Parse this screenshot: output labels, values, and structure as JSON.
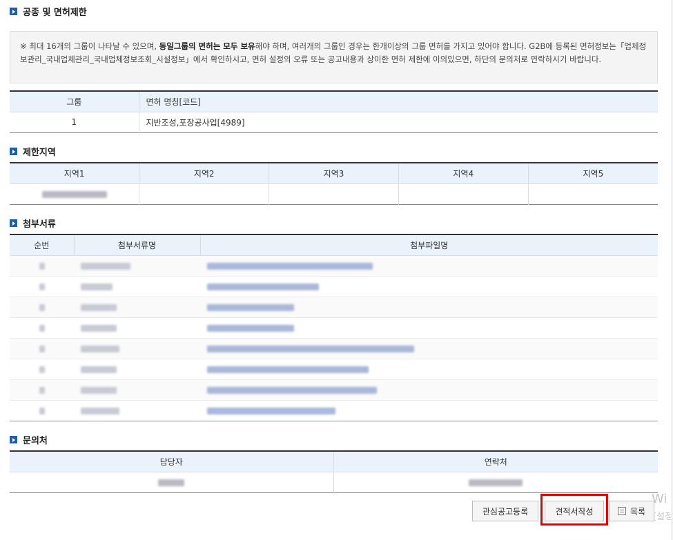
{
  "license_section": {
    "title": "공종 및 면허제한",
    "notice_prefix": "※ 최대 16개의 그룹이 나타날 수 있으며, ",
    "notice_bold": "동일그룹의 면허는 모두 보유",
    "notice_suffix": "해야 하며, 여러개의 그룹인 경우는 한개이상의 그룹 면허를 가지고 있어야 합니다. G2B에 등록된 면허정보는「업체정보관리_국내업체관리_국내업체정보조회_시설정보」에서 확인하시고, 면허 설정의 오류 또는 공고내용과 상이한 면허 제한에 이의있으면, 하단의 문의처로 연락하시기 바랍니다.",
    "headers": {
      "group": "그룹",
      "license_name": "면허 명칭[코드]"
    },
    "rows": [
      {
        "group": "1",
        "license_name": "지반조성,포장공사업[4989]"
      }
    ]
  },
  "region_section": {
    "title": "제한지역",
    "headers": [
      "지역1",
      "지역2",
      "지역3",
      "지역4",
      "지역5"
    ]
  },
  "attachment_section": {
    "title": "첨부서류",
    "headers": {
      "no": "순번",
      "doc_name": "첨부서류명",
      "file_name": "첨부파일명"
    },
    "row_count": 8
  },
  "contact_section": {
    "title": "문의처",
    "headers": {
      "person": "담당자",
      "phone": "연락처"
    }
  },
  "buttons": {
    "interest": "관심공고등록",
    "quote": "견적서작성",
    "list": "목록"
  },
  "watermark": {
    "line1": "Wi",
    "line2": "[설정"
  }
}
